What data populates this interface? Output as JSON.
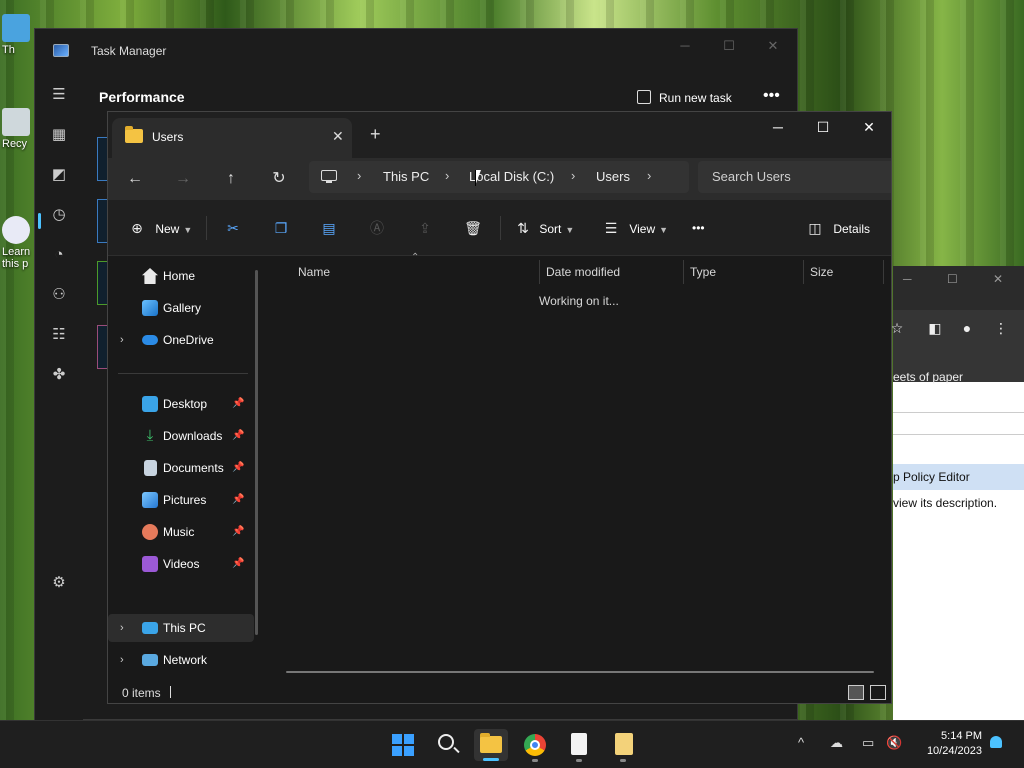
{
  "desktop": {
    "icons": [
      {
        "label": "Th"
      },
      {
        "label": "Recy"
      },
      {
        "label": "Learn this p"
      }
    ]
  },
  "task_manager": {
    "title": "Task Manager",
    "heading": "Performance",
    "run_new_task": "Run new task",
    "more": "•••"
  },
  "chrome_window": {
    "snippet": "eets of paper",
    "policy_editor": "p Policy Editor",
    "description": "view its description."
  },
  "explorer": {
    "tab_label": "Users",
    "breadcrumb": [
      "This PC",
      "Local Disk (C:)",
      "Users"
    ],
    "search_placeholder": "Search Users",
    "toolbar": {
      "new_label": "New",
      "sort_label": "Sort",
      "view_label": "View",
      "more": "•••",
      "details_label": "Details"
    },
    "nav": {
      "quick": [
        "Home",
        "Gallery",
        "OneDrive"
      ],
      "pinned": [
        "Desktop",
        "Downloads",
        "Documents",
        "Pictures",
        "Music",
        "Videos"
      ],
      "bottom": [
        "This PC",
        "Network"
      ]
    },
    "columns": [
      "Name",
      "Date modified",
      "Type",
      "Size"
    ],
    "status_message": "Working on it...",
    "item_count": "0 items"
  },
  "taskbar": {
    "time": "5:14 PM",
    "date": "10/24/2023"
  },
  "colors": {
    "accent": "#4cc2ff",
    "folder": "#f4c343",
    "explorer_bg": "#191919"
  }
}
